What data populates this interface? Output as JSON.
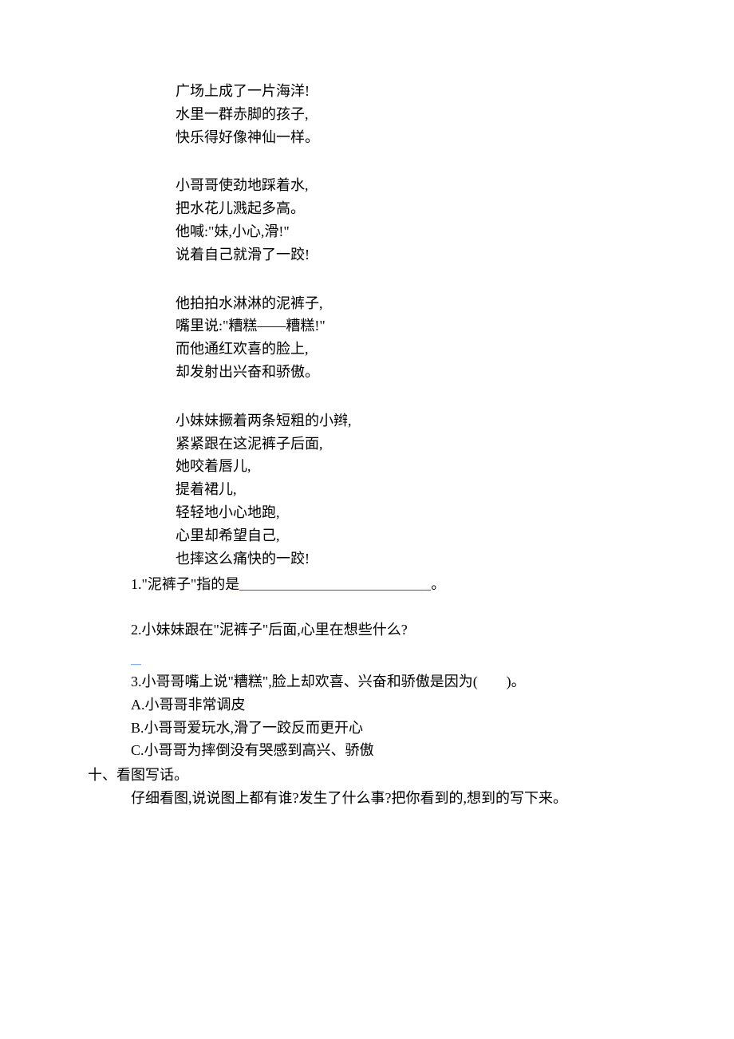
{
  "poem": {
    "stanza1": [
      "广场上成了一片海洋!",
      "水里一群赤脚的孩子,",
      "快乐得好像神仙一样。"
    ],
    "stanza2": [
      "小哥哥使劲地踩着水,",
      "把水花儿溅起多高。",
      "他喊:\"妹,小心,滑!\"",
      "说着自己就滑了一跤!"
    ],
    "stanza3": [
      "他拍拍水淋淋的泥裤子,",
      "嘴里说:\"糟糕——糟糕!\"",
      "而他通红欢喜的脸上,",
      "却发射出兴奋和骄傲。"
    ],
    "stanza4": [
      "小妹妹撅着两条短粗的小辫,",
      "紧紧跟在这泥裤子后面,",
      "她咬着唇儿,",
      "提着裙儿,",
      "轻轻地小心地跑,",
      "心里却希望自己,",
      "也摔这么痛快的一跤!"
    ]
  },
  "q1_pre": "1.\"泥裤子\"指的是",
  "q1_post": "。",
  "q2": "2.小妹妹跟在\"泥裤子\"后面,心里在想些什么?",
  "q3": "3.小哥哥嘴上说\"糟糕\",脸上却欢喜、兴奋和骄傲是因为(　　)。",
  "opts": {
    "A": "A.小哥哥非常调皮",
    "B": "B.小哥哥爱玩水,滑了一跤反而更开心",
    "C": "C.小哥哥为摔倒没有哭感到高兴、骄傲"
  },
  "sec10_title": "十、看图写话。",
  "sec10_body": "仔细看图,说说图上都有谁?发生了什么事?把你看到的,想到的写下来。"
}
